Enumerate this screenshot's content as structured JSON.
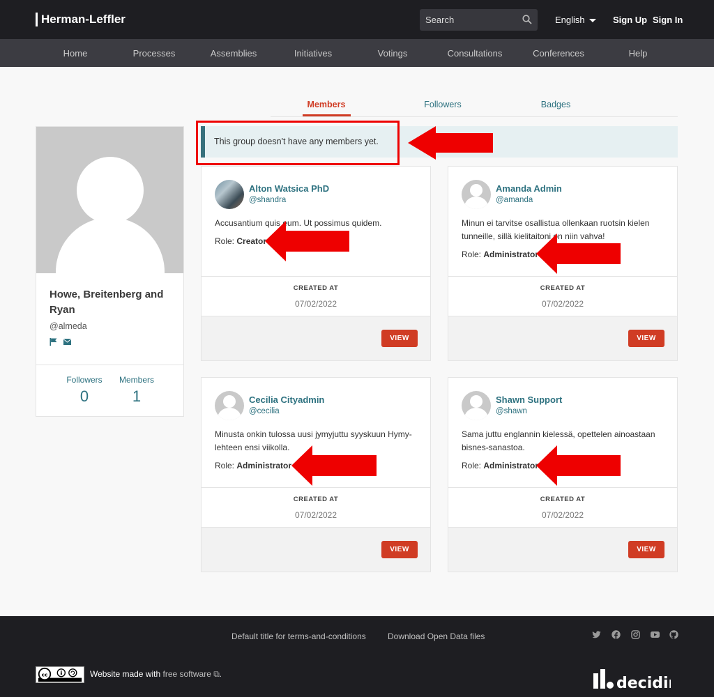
{
  "header": {
    "org_name": "Herman-Leffler",
    "search_placeholder": "Search",
    "language": "English",
    "sign_up": "Sign Up",
    "sign_in": "Sign In"
  },
  "nav": [
    "Home",
    "Processes",
    "Assemblies",
    "Initiatives",
    "Votings",
    "Consultations",
    "Conferences",
    "Help"
  ],
  "tabs": [
    "Members",
    "Followers",
    "Badges"
  ],
  "profile": {
    "name": "Howe, Breitenberg and Ryan",
    "nickname": "@almeda",
    "followers_label": "Followers",
    "followers_count": "0",
    "members_label": "Members",
    "members_count": "1"
  },
  "callout": "This group doesn't have any members yet.",
  "cards": [
    {
      "name": "Alton Watsica PhD",
      "nickname": "@shandra",
      "bio": "Accusantium quis eum. Ut possimus quidem.",
      "role_label": "Role:",
      "role": "Creator",
      "created_label": "CREATED AT",
      "date": "07/02/2022",
      "view": "VIEW"
    },
    {
      "name": "Amanda Admin",
      "nickname": "@amanda",
      "bio": "Minun ei tarvitse osallistua ollenkaan ruotsin kielen tunneille, sillä kielitaitoni on niin vahva!",
      "role_label": "Role:",
      "role": "Administrator",
      "created_label": "CREATED AT",
      "date": "07/02/2022",
      "view": "VIEW"
    },
    {
      "name": "Cecilia Cityadmin",
      "nickname": "@cecilia",
      "bio": "Minusta onkin tulossa uusi jymyjuttu syyskuun Hymy-lehteen ensi viikolla.",
      "role_label": "Role:",
      "role": "Administrator",
      "created_label": "CREATED AT",
      "date": "07/02/2022",
      "view": "VIEW"
    },
    {
      "name": "Shawn Support",
      "nickname": "@shawn",
      "bio": "Sama juttu englannin kielessä, opettelen ainoastaan bisnes-sanastoa.",
      "role_label": "Role:",
      "role": "Administrator",
      "created_label": "CREATED AT",
      "date": "07/02/2022",
      "view": "VIEW"
    }
  ],
  "footer": {
    "terms": "Default title for terms-and-conditions",
    "open_data": "Download Open Data files",
    "made_with": "Website made with",
    "free_software": "free software",
    "social_icons": [
      "twitter-icon",
      "facebook-icon",
      "instagram-icon",
      "youtube-icon",
      "github-icon"
    ],
    "brand": "decidim"
  },
  "colors": {
    "accent": "#d03c24",
    "link": "#2e7280",
    "annotation": "#ee0000"
  }
}
